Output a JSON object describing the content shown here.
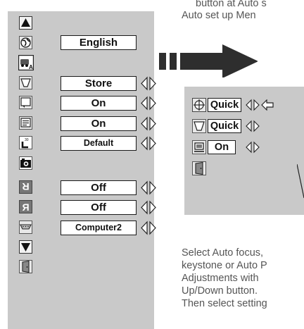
{
  "top_text": {
    "line1": "button at Auto s",
    "line2": "Auto set up Men"
  },
  "menu": {
    "items": [
      {
        "icon": "up-arrow-icon"
      },
      {
        "icon": "globe-icon",
        "value": "English"
      },
      {
        "icon": "auto-setup-icon"
      },
      {
        "icon": "keystone-icon",
        "value": "Store"
      },
      {
        "icon": "screen-blank-icon",
        "value": "On"
      },
      {
        "icon": "display-icon",
        "value": "On"
      },
      {
        "icon": "logo-icon",
        "value": "Default"
      },
      {
        "icon": "camera-icon"
      },
      {
        "icon": "ceiling-icon",
        "value": "Off"
      },
      {
        "icon": "rear-icon",
        "value": "Off"
      },
      {
        "icon": "terminal-icon",
        "value": "Computer2"
      },
      {
        "icon": "down-arrow-icon"
      },
      {
        "icon": "exit-door-icon"
      }
    ]
  },
  "auto_setup": {
    "items": [
      {
        "icon": "auto-pc-adjust-icon",
        "value": "Quick"
      },
      {
        "icon": "keystone-icon",
        "value": "Quick"
      },
      {
        "icon": "auto-focus-icon",
        "value": "On"
      },
      {
        "icon": "exit-door-icon"
      }
    ]
  },
  "bottom_text": {
    "line1": "Select Auto focus,",
    "line2": "keystone or Auto P",
    "line3": "Adjustments with",
    "line4": "Up/Down button.",
    "line5": "Then select setting"
  },
  "colors": {
    "panel": "#c9c9c9",
    "text": "#555555",
    "arrow": "#2e2e2e"
  }
}
